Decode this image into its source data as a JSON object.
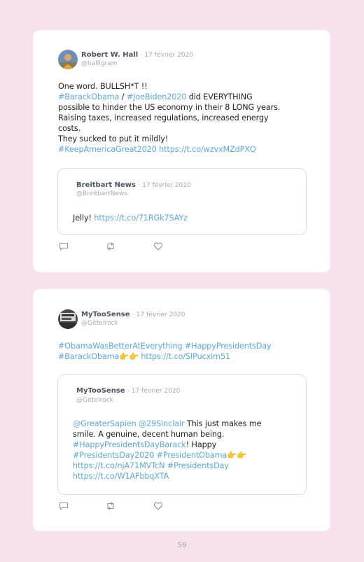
{
  "tweets": [
    {
      "author": "Robert W. Hall",
      "sep": "·",
      "date": "17 février 2020",
      "handle": "@halligram",
      "lines": [
        [
          {
            "t": "One word. BULLSH*T !!",
            "link": false
          }
        ],
        [
          {
            "t": "#BarackObama",
            "link": true
          },
          {
            "t": " / ",
            "link": false
          },
          {
            "t": "#JoeBiden2020",
            "link": true
          },
          {
            "t": " did EVERYTHING",
            "link": false
          }
        ],
        [
          {
            "t": "possible to hinder the US economy in their 8 LONG years.",
            "link": false
          }
        ],
        [
          {
            "t": "Raising taxes, increased regulations, increased energy",
            "link": false
          }
        ],
        [
          {
            "t": "costs.",
            "link": false
          }
        ],
        [
          {
            "t": "They sucked to put it mildly!",
            "link": false
          }
        ],
        [
          {
            "t": "#KeepAmericaGreat2020 https://t.co/wzvxMZdPXQ",
            "link": true
          }
        ]
      ],
      "quote": {
        "author": "Breitbart News",
        "sep": "·",
        "date": "17 février 2020",
        "handle": "@BreitbartNews",
        "lines": [
          [
            {
              "t": "Jelly! ",
              "link": false
            },
            {
              "t": "https://t.co/71RGk7SAYz",
              "link": true
            }
          ]
        ]
      }
    },
    {
      "author": "MyTooSense",
      "sep": "·",
      "date": "17 février 2020",
      "handle": "@Gittelrock",
      "lines": [
        [
          {
            "t": "#ObamaWasBetterAtEverything #HappyPresidentsDay",
            "link": true
          }
        ],
        [
          {
            "t": "#BarackObama👉👉 https://t.co/SIPucxim51",
            "link": true
          }
        ]
      ],
      "quote": {
        "author": "MyTooSense",
        "sep": "·",
        "date": "17 février 2020",
        "handle": "@Gittelrock",
        "lines": [
          [
            {
              "t": "@GreaterSapien @29Sinclair",
              "link": true
            },
            {
              "t": " This just makes me",
              "link": false
            }
          ],
          [
            {
              "t": "smile. A genuine, decent human being.",
              "link": false
            }
          ],
          [
            {
              "t": "#HappyPresidentsDayBarack",
              "link": true
            },
            {
              "t": "! Happy",
              "link": false
            }
          ],
          [
            {
              "t": "#PresidentsDay2020 #PresidentObama👉👉",
              "link": true
            }
          ],
          [
            {
              "t": "https://t.co/njA71MVTcN #PresidentsDay",
              "link": true
            }
          ],
          [
            {
              "t": "https://t.co/W1AFbbqXTA",
              "link": true
            }
          ]
        ]
      }
    }
  ],
  "icons": [
    "reply-icon",
    "retweet-icon",
    "like-icon"
  ],
  "colors": {
    "background": "#f6e1ec",
    "link": "#5aa7de",
    "card": "#ffffff"
  },
  "page_number": "59"
}
